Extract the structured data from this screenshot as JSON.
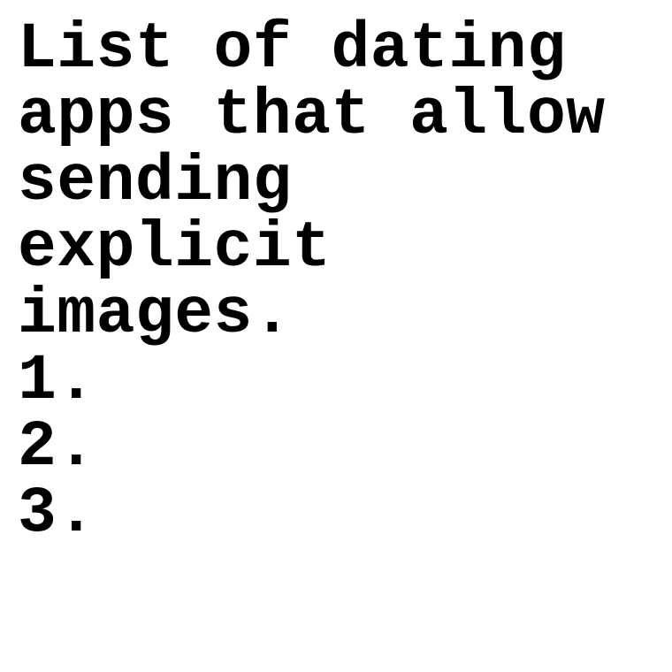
{
  "title_lines": [
    "List of dating",
    "apps that allow",
    "sending",
    "explicit",
    "images."
  ],
  "list_items": [
    "1.",
    "2.",
    "3."
  ]
}
